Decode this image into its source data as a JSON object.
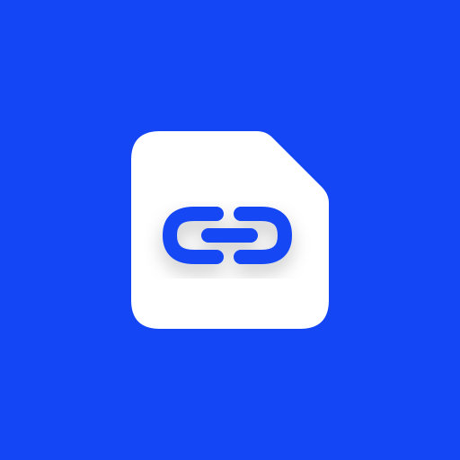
{
  "background_color": "#1446f5",
  "icon": {
    "name": "file-link-icon",
    "document_color": "#ffffff",
    "link_color": "#1446f5"
  }
}
